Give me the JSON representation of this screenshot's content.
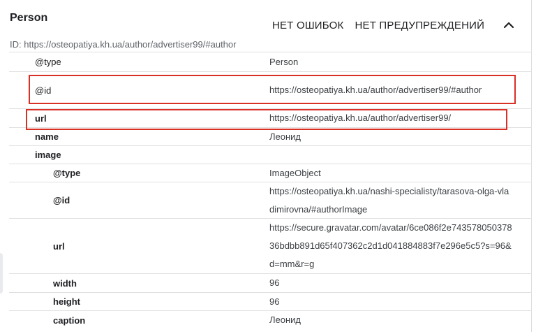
{
  "header": {
    "title": "Person",
    "no_errors": "НЕТ ОШИБОК",
    "no_warnings": "НЕТ ПРЕДУПРЕЖДЕНИЙ",
    "collapse_icon": "chevron-up-icon",
    "id_line": "ID: https://osteopatiya.kh.ua/author/advertiser99/#author"
  },
  "rows": [
    {
      "key": "@type",
      "value": "Person"
    },
    {
      "key": "@id",
      "value": "https://osteopatiya.kh.ua/author/advertiser99/#author"
    },
    {
      "key": "url",
      "value": "https://osteopatiya.kh.ua/author/advertiser99/"
    },
    {
      "key": "name",
      "value": "Леонид"
    },
    {
      "key": "image",
      "value": ""
    },
    {
      "key": "@type",
      "value": "ImageObject"
    },
    {
      "key": "@id",
      "value": "https://osteopatiya.kh.ua/nashi-specialisty/tarasova-olga-vladimirovna/#authorImage"
    },
    {
      "key": "url",
      "value": "https://secure.gravatar.com/avatar/6ce086f2e74357805037836bdbb891d65f407362c2d1d041884883f7e296e5c5?s=96&d=mm&r=g"
    },
    {
      "key": "width",
      "value": "96"
    },
    {
      "key": "height",
      "value": "96"
    },
    {
      "key": "caption",
      "value": "Леонид"
    }
  ],
  "colors": {
    "highlight": "#d93025",
    "divider": "#e0e0e0"
  }
}
